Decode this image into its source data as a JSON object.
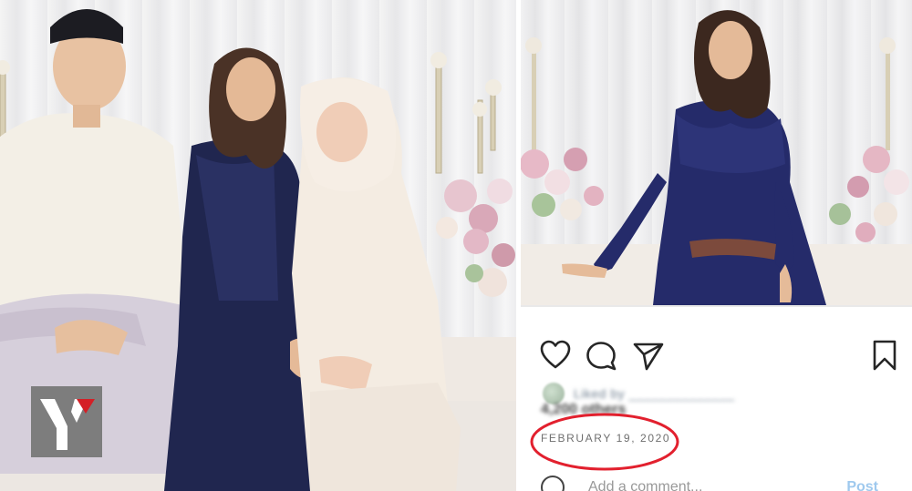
{
  "post": {
    "likes_blurred": "Liked by ______________",
    "likes_count": "4,200 others",
    "date": "FEBRUARY 19, 2020",
    "comment_placeholder": "Add a comment...",
    "post_label": "Post"
  },
  "icons": {
    "like": "heart-icon",
    "comment": "comment-icon",
    "share": "paper-plane-icon",
    "save": "bookmark-icon",
    "logo": "y-logo"
  },
  "colors": {
    "annotation_circle": "#e2202e",
    "logo_bg": "#7d7d7d",
    "logo_accent": "#d41f26",
    "post_link": "#9fc9ee"
  }
}
